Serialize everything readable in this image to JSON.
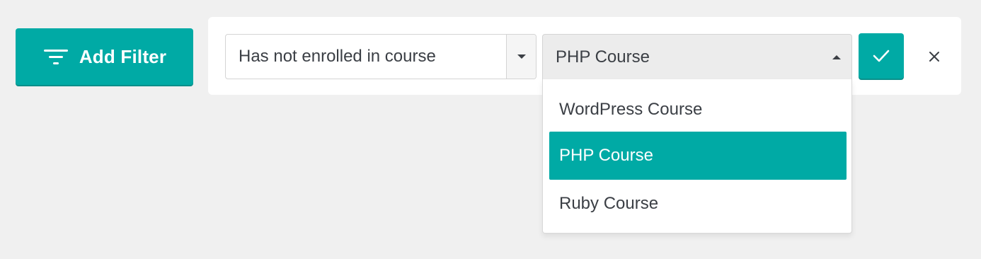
{
  "add_filter": {
    "label": "Add Filter",
    "icon": "filter-lines-icon"
  },
  "filter_row": {
    "condition": {
      "value": "Has not enrolled in course",
      "toggle_icon": "caret-down-icon"
    },
    "course": {
      "value": "PHP Course",
      "toggle_icon": "caret-up-icon",
      "options": [
        {
          "label": "WordPress Course",
          "selected": false
        },
        {
          "label": "PHP Course",
          "selected": true
        },
        {
          "label": "Ruby Course",
          "selected": false
        }
      ]
    },
    "confirm_icon": "checkmark-icon",
    "close_icon": "close-icon"
  },
  "colors": {
    "accent": "#00aaa5",
    "text": "#3b3f45",
    "background": "#f0f0f0"
  }
}
